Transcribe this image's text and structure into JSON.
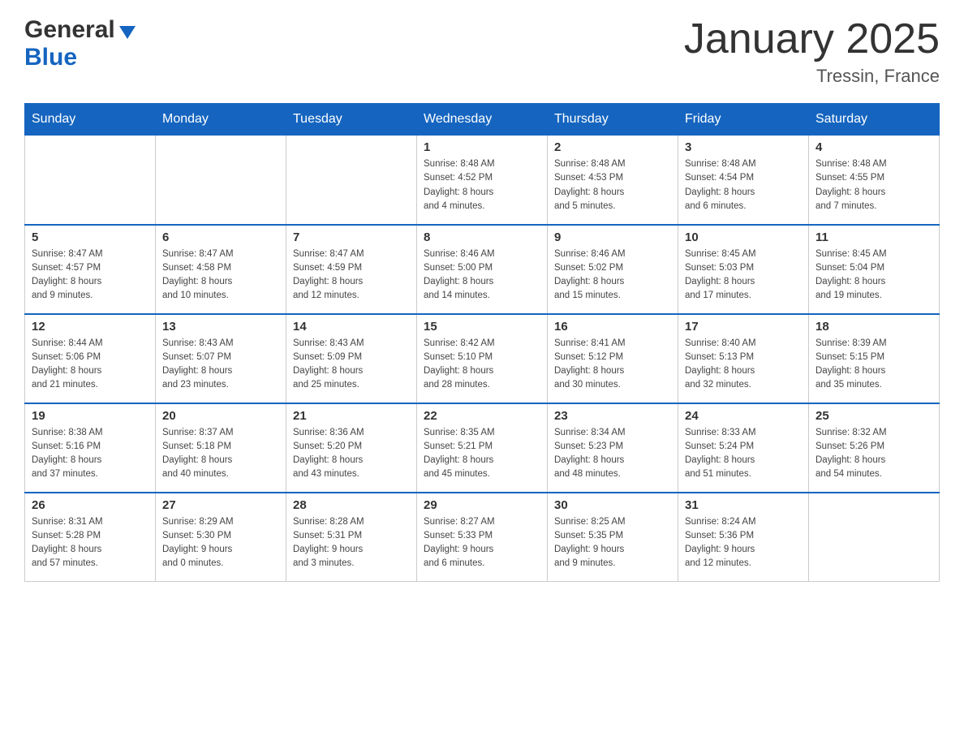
{
  "header": {
    "logo_general": "General",
    "logo_blue": "Blue",
    "month_title": "January 2025",
    "location": "Tressin, France"
  },
  "days_of_week": [
    "Sunday",
    "Monday",
    "Tuesday",
    "Wednesday",
    "Thursday",
    "Friday",
    "Saturday"
  ],
  "weeks": [
    [
      {
        "day": "",
        "info": ""
      },
      {
        "day": "",
        "info": ""
      },
      {
        "day": "",
        "info": ""
      },
      {
        "day": "1",
        "info": "Sunrise: 8:48 AM\nSunset: 4:52 PM\nDaylight: 8 hours\nand 4 minutes."
      },
      {
        "day": "2",
        "info": "Sunrise: 8:48 AM\nSunset: 4:53 PM\nDaylight: 8 hours\nand 5 minutes."
      },
      {
        "day": "3",
        "info": "Sunrise: 8:48 AM\nSunset: 4:54 PM\nDaylight: 8 hours\nand 6 minutes."
      },
      {
        "day": "4",
        "info": "Sunrise: 8:48 AM\nSunset: 4:55 PM\nDaylight: 8 hours\nand 7 minutes."
      }
    ],
    [
      {
        "day": "5",
        "info": "Sunrise: 8:47 AM\nSunset: 4:57 PM\nDaylight: 8 hours\nand 9 minutes."
      },
      {
        "day": "6",
        "info": "Sunrise: 8:47 AM\nSunset: 4:58 PM\nDaylight: 8 hours\nand 10 minutes."
      },
      {
        "day": "7",
        "info": "Sunrise: 8:47 AM\nSunset: 4:59 PM\nDaylight: 8 hours\nand 12 minutes."
      },
      {
        "day": "8",
        "info": "Sunrise: 8:46 AM\nSunset: 5:00 PM\nDaylight: 8 hours\nand 14 minutes."
      },
      {
        "day": "9",
        "info": "Sunrise: 8:46 AM\nSunset: 5:02 PM\nDaylight: 8 hours\nand 15 minutes."
      },
      {
        "day": "10",
        "info": "Sunrise: 8:45 AM\nSunset: 5:03 PM\nDaylight: 8 hours\nand 17 minutes."
      },
      {
        "day": "11",
        "info": "Sunrise: 8:45 AM\nSunset: 5:04 PM\nDaylight: 8 hours\nand 19 minutes."
      }
    ],
    [
      {
        "day": "12",
        "info": "Sunrise: 8:44 AM\nSunset: 5:06 PM\nDaylight: 8 hours\nand 21 minutes."
      },
      {
        "day": "13",
        "info": "Sunrise: 8:43 AM\nSunset: 5:07 PM\nDaylight: 8 hours\nand 23 minutes."
      },
      {
        "day": "14",
        "info": "Sunrise: 8:43 AM\nSunset: 5:09 PM\nDaylight: 8 hours\nand 25 minutes."
      },
      {
        "day": "15",
        "info": "Sunrise: 8:42 AM\nSunset: 5:10 PM\nDaylight: 8 hours\nand 28 minutes."
      },
      {
        "day": "16",
        "info": "Sunrise: 8:41 AM\nSunset: 5:12 PM\nDaylight: 8 hours\nand 30 minutes."
      },
      {
        "day": "17",
        "info": "Sunrise: 8:40 AM\nSunset: 5:13 PM\nDaylight: 8 hours\nand 32 minutes."
      },
      {
        "day": "18",
        "info": "Sunrise: 8:39 AM\nSunset: 5:15 PM\nDaylight: 8 hours\nand 35 minutes."
      }
    ],
    [
      {
        "day": "19",
        "info": "Sunrise: 8:38 AM\nSunset: 5:16 PM\nDaylight: 8 hours\nand 37 minutes."
      },
      {
        "day": "20",
        "info": "Sunrise: 8:37 AM\nSunset: 5:18 PM\nDaylight: 8 hours\nand 40 minutes."
      },
      {
        "day": "21",
        "info": "Sunrise: 8:36 AM\nSunset: 5:20 PM\nDaylight: 8 hours\nand 43 minutes."
      },
      {
        "day": "22",
        "info": "Sunrise: 8:35 AM\nSunset: 5:21 PM\nDaylight: 8 hours\nand 45 minutes."
      },
      {
        "day": "23",
        "info": "Sunrise: 8:34 AM\nSunset: 5:23 PM\nDaylight: 8 hours\nand 48 minutes."
      },
      {
        "day": "24",
        "info": "Sunrise: 8:33 AM\nSunset: 5:24 PM\nDaylight: 8 hours\nand 51 minutes."
      },
      {
        "day": "25",
        "info": "Sunrise: 8:32 AM\nSunset: 5:26 PM\nDaylight: 8 hours\nand 54 minutes."
      }
    ],
    [
      {
        "day": "26",
        "info": "Sunrise: 8:31 AM\nSunset: 5:28 PM\nDaylight: 8 hours\nand 57 minutes."
      },
      {
        "day": "27",
        "info": "Sunrise: 8:29 AM\nSunset: 5:30 PM\nDaylight: 9 hours\nand 0 minutes."
      },
      {
        "day": "28",
        "info": "Sunrise: 8:28 AM\nSunset: 5:31 PM\nDaylight: 9 hours\nand 3 minutes."
      },
      {
        "day": "29",
        "info": "Sunrise: 8:27 AM\nSunset: 5:33 PM\nDaylight: 9 hours\nand 6 minutes."
      },
      {
        "day": "30",
        "info": "Sunrise: 8:25 AM\nSunset: 5:35 PM\nDaylight: 9 hours\nand 9 minutes."
      },
      {
        "day": "31",
        "info": "Sunrise: 8:24 AM\nSunset: 5:36 PM\nDaylight: 9 hours\nand 12 minutes."
      },
      {
        "day": "",
        "info": ""
      }
    ]
  ]
}
